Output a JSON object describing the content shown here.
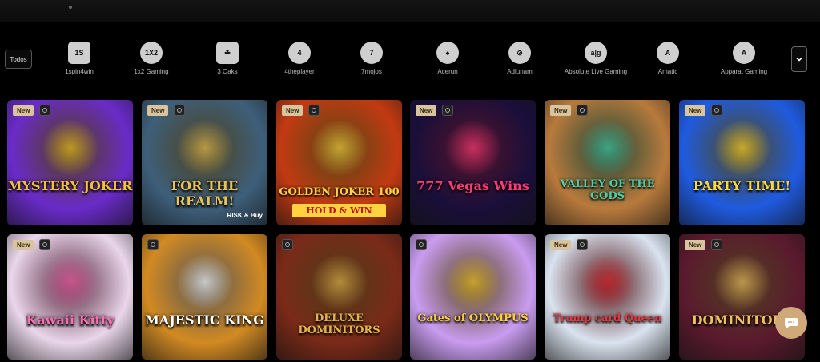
{
  "filters": {
    "all_label": "Todos"
  },
  "providers": [
    {
      "name": "1spin4win",
      "logo": "1S",
      "icon": "1spin4win-logo-icon"
    },
    {
      "name": "1x2 Gaming",
      "logo": "1X2",
      "icon": "1x2-gaming-logo-icon"
    },
    {
      "name": "3 Oaks",
      "logo": "☘",
      "icon": "3-oaks-logo-icon"
    },
    {
      "name": "4theplayer",
      "logo": "4",
      "icon": "4theplayer-logo-icon"
    },
    {
      "name": "7mojos",
      "logo": "7",
      "icon": "7mojos-logo-icon"
    },
    {
      "name": "Acerun",
      "logo": "♠",
      "icon": "acerun-logo-icon"
    },
    {
      "name": "Adlunam",
      "logo": "⊘",
      "icon": "adlunam-logo-icon"
    },
    {
      "name": "Absolute Live Gaming",
      "logo": "a|g",
      "icon": "absolute-live-gaming-logo-icon"
    },
    {
      "name": "Amatic",
      "logo": "A",
      "icon": "amatic-logo-icon"
    },
    {
      "name": "Apparat Gaming",
      "logo": "A",
      "icon": "apparat-gaming-logo-icon"
    }
  ],
  "badge": {
    "new_label": "New"
  },
  "games": [
    {
      "title": "MYSTERY JOKER",
      "bg": "#6a2bc9",
      "accent": "#f2c230",
      "new": true
    },
    {
      "title": "FOR THE REALM!",
      "bg": "#3e5f7a",
      "accent": "#e8c35a",
      "new": true,
      "extra": "RISK & Buy"
    },
    {
      "title": "GOLDEN JOKER 100",
      "subtitle": "HOLD & WIN",
      "bg": "#c23a12",
      "accent": "#ffd23f",
      "new": true
    },
    {
      "title": "777 Vegas Wins",
      "bg": "#1a0f3a",
      "accent": "#ff3b7a",
      "new": true
    },
    {
      "title": "VALLEY OF THE GODS",
      "bg": "#b87a3c",
      "accent": "#4fd1a8",
      "new": true
    },
    {
      "title": "PARTY TIME!",
      "bg": "#1f5be0",
      "accent": "#ffd83a",
      "new": true
    },
    {
      "title": "Kawaii Kitty",
      "bg": "#e9d6ea",
      "accent": "#ff6fb5",
      "new": true
    },
    {
      "title": "MAJESTIC KING",
      "bg": "#d28a22",
      "accent": "#ffffff",
      "new": false
    },
    {
      "title": "DELUXE DOMINITORS",
      "bg": "#7a2a18",
      "accent": "#e6b34a",
      "new": false
    },
    {
      "title": "Gates of OLYMPUS",
      "bg": "#c99cf0",
      "accent": "#ffcf3a",
      "new": false
    },
    {
      "title": "Trump card Queen",
      "bg": "#d9e3ef",
      "accent": "#e8363e",
      "new": true
    },
    {
      "title": "DOMINITORS",
      "bg": "#5a1a2e",
      "accent": "#f0c060",
      "new": true
    }
  ]
}
